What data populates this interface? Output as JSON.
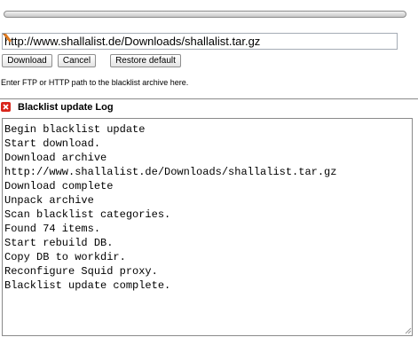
{
  "progress": {
    "value": 0
  },
  "url_input": {
    "value": "http://www.shallalist.de/Downloads/shallalist.tar.gz"
  },
  "buttons": {
    "download": "Download",
    "cancel": "Cancel",
    "restore": "Restore default"
  },
  "hint": "Enter FTP or HTTP path to the blacklist archive here.",
  "log": {
    "title": "Blacklist update Log",
    "lines": [
      "Begin blacklist update",
      "Start download.",
      "Download archive",
      "http://www.shallalist.de/Downloads/shallalist.tar.gz",
      "Download complete",
      "Unpack archive",
      "Scan blacklist categories.",
      "Found 74 items.",
      "Start rebuild DB.",
      "Copy DB to workdir.",
      "Reconfigure Squid proxy.",
      "Blacklist update complete."
    ]
  },
  "icons": {
    "url_field": "edit-pencil-icon",
    "log_header": "error-x-icon"
  },
  "colors": {
    "error_icon": "#d9261c"
  }
}
